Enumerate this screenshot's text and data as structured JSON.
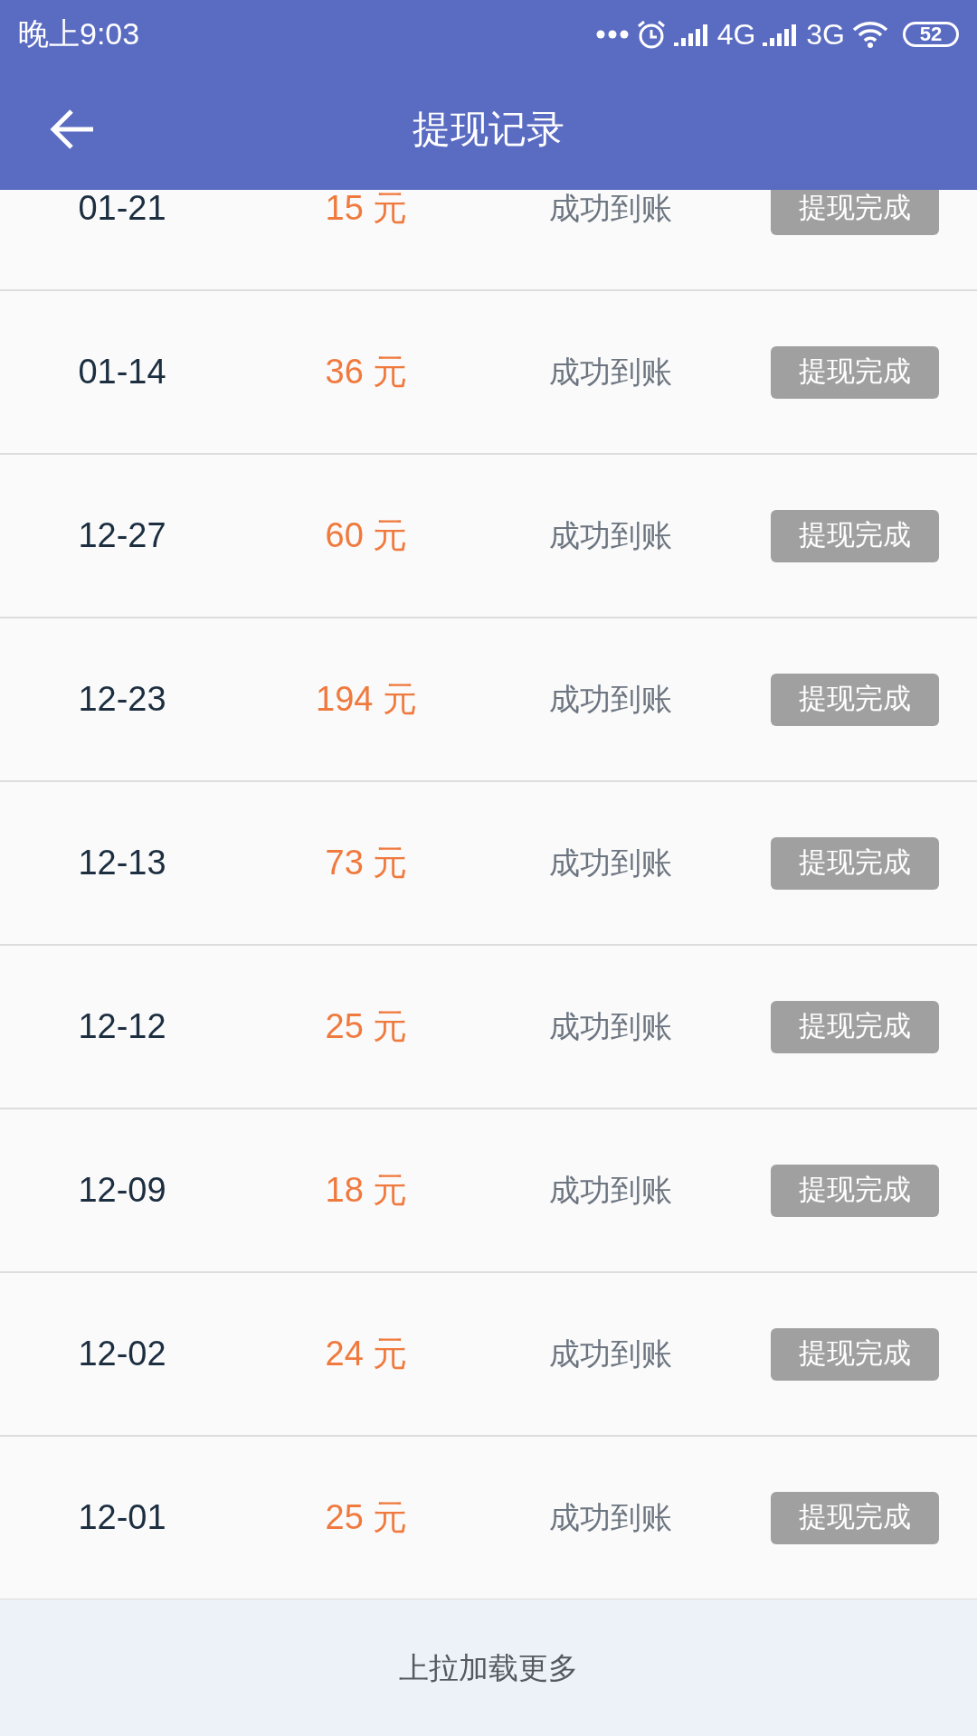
{
  "status_bar": {
    "time": "晚上9:03",
    "network_1": "4G",
    "network_2": "3G",
    "battery": "52"
  },
  "header": {
    "title": "提现记录"
  },
  "records": [
    {
      "date": "01-21",
      "amount": "15 元",
      "status": "成功到账",
      "action": "提现完成"
    },
    {
      "date": "01-14",
      "amount": "36 元",
      "status": "成功到账",
      "action": "提现完成"
    },
    {
      "date": "12-27",
      "amount": "60 元",
      "status": "成功到账",
      "action": "提现完成"
    },
    {
      "date": "12-23",
      "amount": "194 元",
      "status": "成功到账",
      "action": "提现完成"
    },
    {
      "date": "12-13",
      "amount": "73 元",
      "status": "成功到账",
      "action": "提现完成"
    },
    {
      "date": "12-12",
      "amount": "25 元",
      "status": "成功到账",
      "action": "提现完成"
    },
    {
      "date": "12-09",
      "amount": "18 元",
      "status": "成功到账",
      "action": "提现完成"
    },
    {
      "date": "12-02",
      "amount": "24 元",
      "status": "成功到账",
      "action": "提现完成"
    },
    {
      "date": "12-01",
      "amount": "25 元",
      "status": "成功到账",
      "action": "提现完成"
    }
  ],
  "footer": {
    "text": "上拉加载更多"
  }
}
